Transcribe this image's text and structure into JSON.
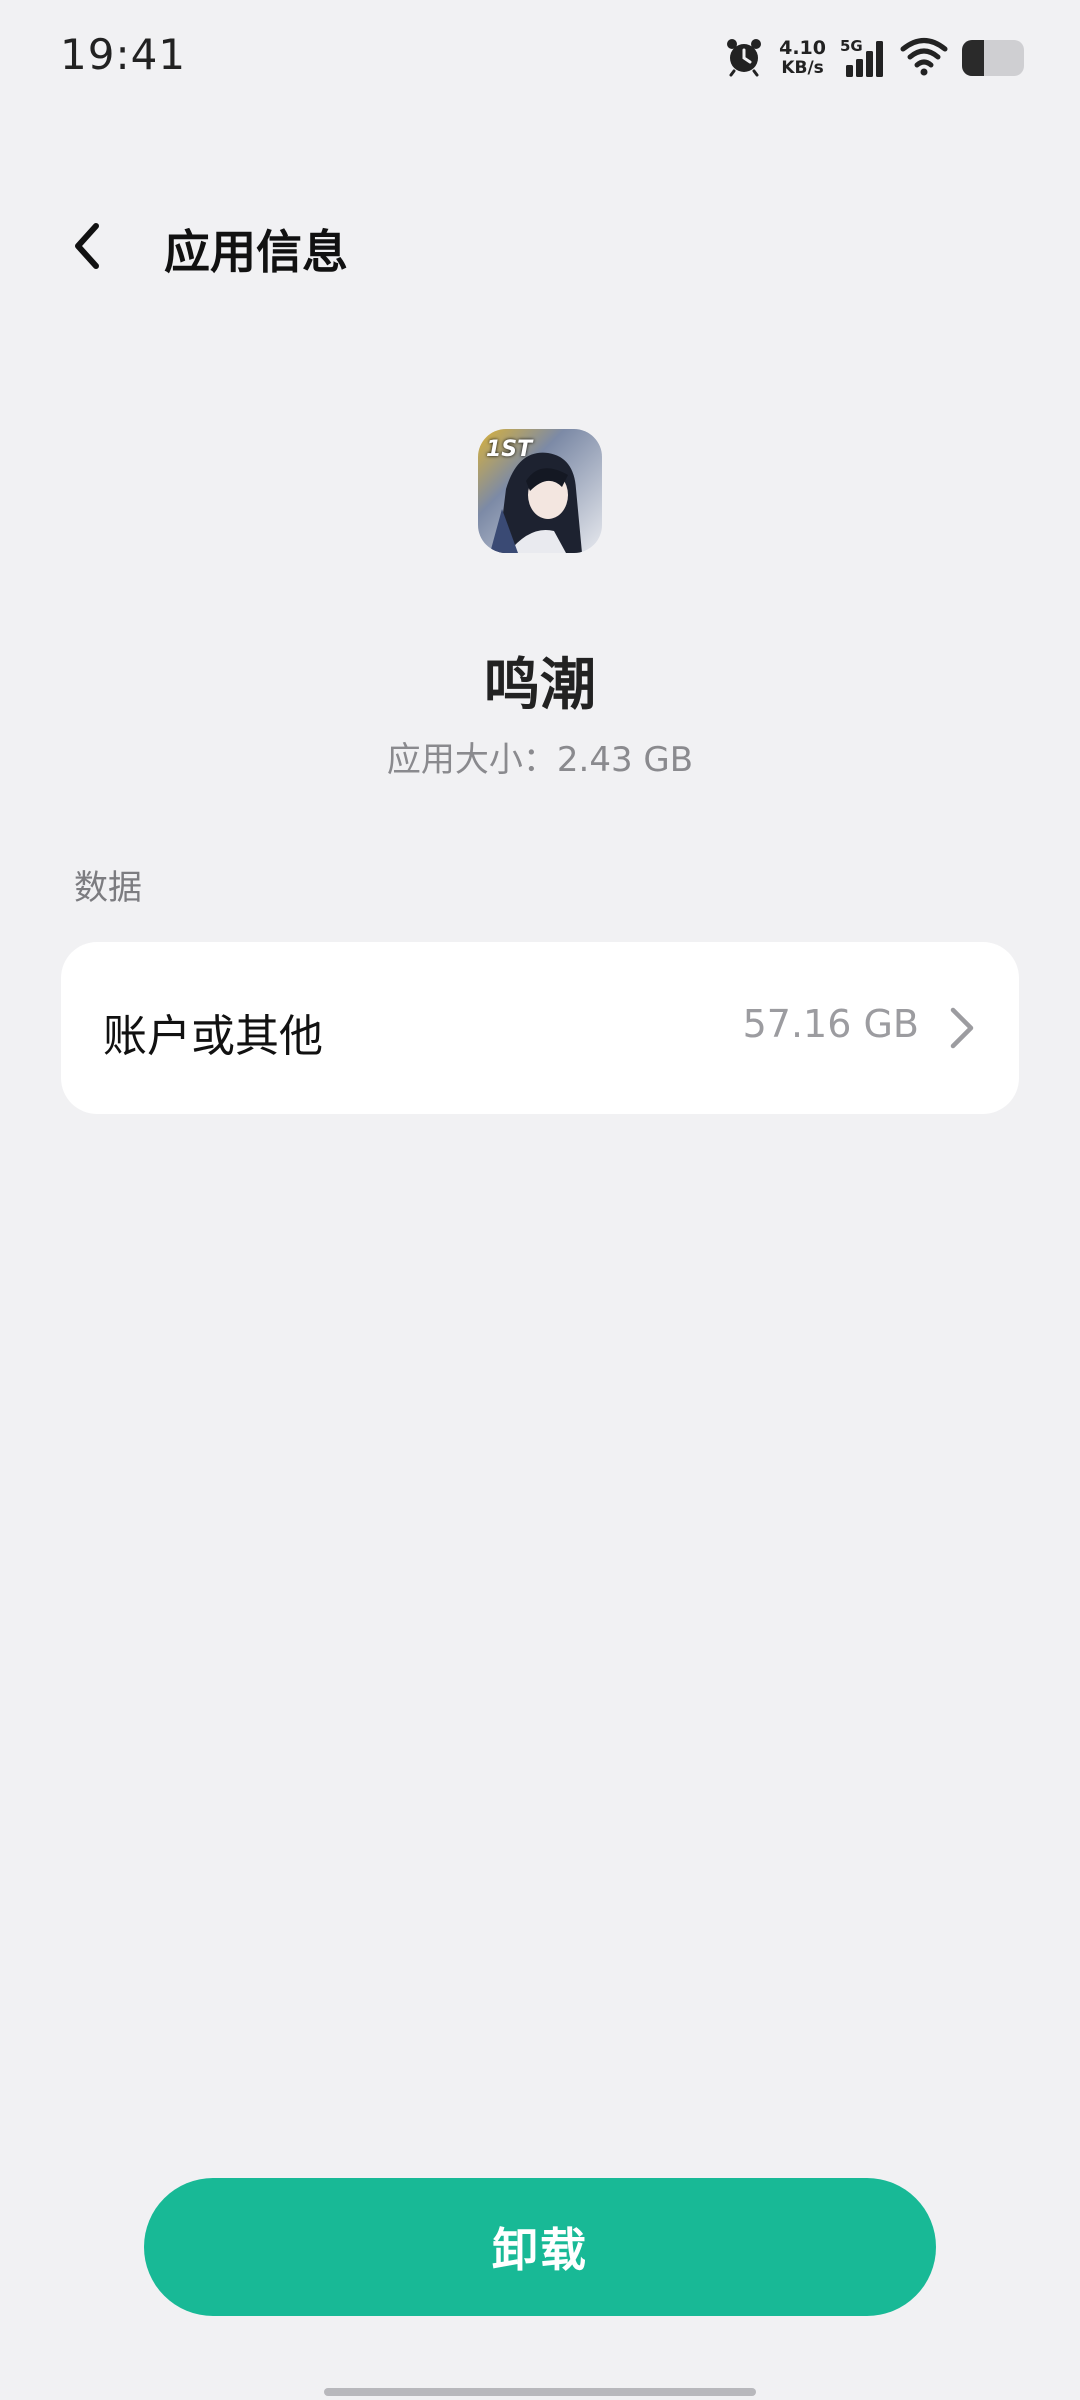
{
  "status_bar": {
    "time": "19:41",
    "net_speed_value": "4.10",
    "net_speed_unit": "KB/s",
    "network_type": "5G",
    "battery_level": 0.35,
    "icons": [
      "alarm-icon",
      "signal-icon",
      "wifi-icon",
      "battery-icon"
    ]
  },
  "header": {
    "back_icon": "chevron-left-icon",
    "title": "应用信息"
  },
  "app": {
    "name": "鸣潮",
    "size_label": "应用大小：",
    "size_value": "2.43 GB",
    "icon_badge": "1ST"
  },
  "data_section": {
    "label": "数据",
    "items": [
      {
        "label": "账户或其他",
        "value": "57.16 GB",
        "icon": "chevron-right-icon"
      }
    ]
  },
  "actions": {
    "uninstall_label": "卸载"
  },
  "colors": {
    "background": "#f1f1f3",
    "card": "#ffffff",
    "accent": "#18b996",
    "secondary_text": "#8a8a8e"
  }
}
